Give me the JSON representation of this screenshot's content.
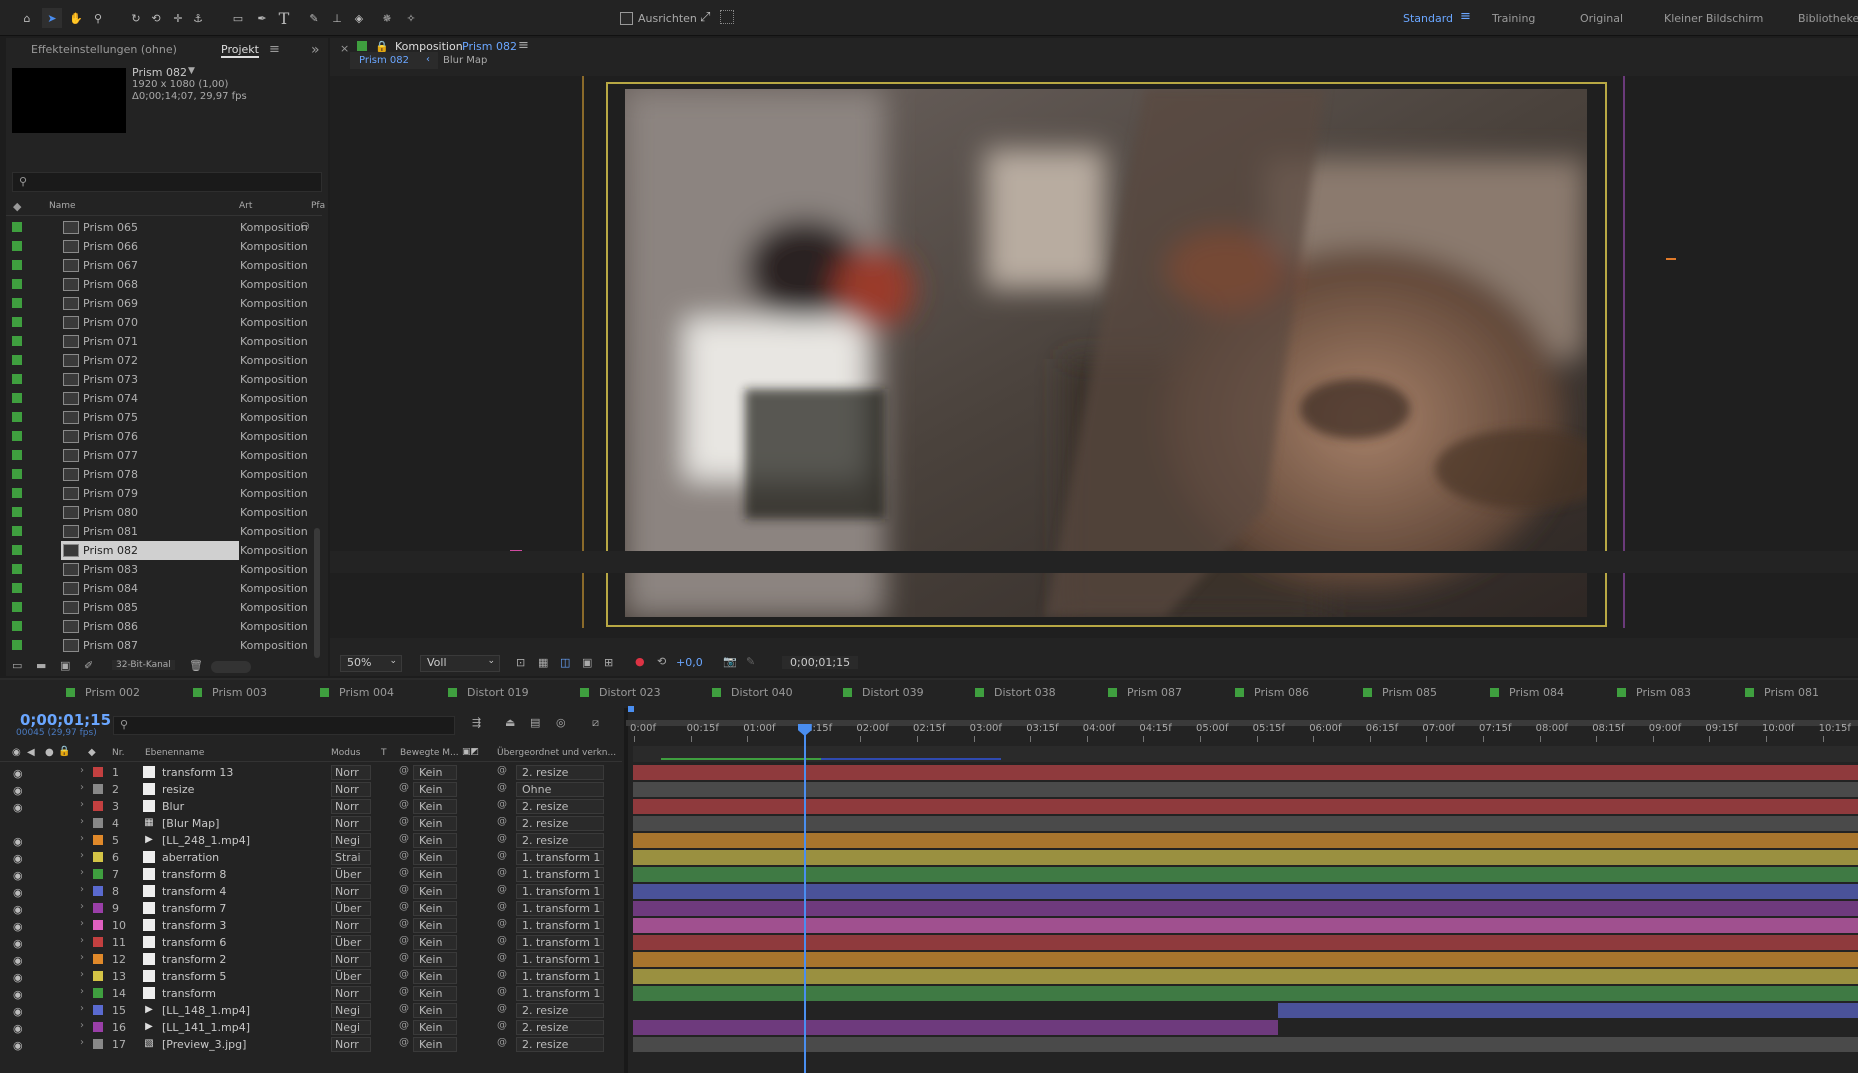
{
  "toolbar": {
    "align_label": "Ausrichten",
    "workspaces": [
      "Standard",
      "Training",
      "Original",
      "Kleiner Bildschirm",
      "Bibliotheken"
    ],
    "active_workspace": "Standard",
    "icons": [
      "home-icon",
      "selection-arrow-icon",
      "hand-icon",
      "zoom-icon",
      "rotate-icon",
      "camera-orbit-icon",
      "pan-behind-icon",
      "anchor-icon",
      "rectangle-icon",
      "pen-icon",
      "text-icon",
      "brush-icon",
      "clone-stamp-icon",
      "eraser-icon",
      "roto-brush-icon",
      "puppet-pin-icon"
    ]
  },
  "project": {
    "tab_effects": "Effekteinstellungen (ohne)",
    "tab_project": "Projekt",
    "preview_name": "Prism 082",
    "preview_res": "1920 x 1080 (1,00)",
    "preview_dur": "Δ0;00;14;07, 29,97 fps",
    "search_placeholder": "",
    "col_name": "Name",
    "col_art": "Art",
    "col_pfa": "Pfa",
    "selected": "Prism 082",
    "items": [
      {
        "name": "Prism 065",
        "art": "Komposition"
      },
      {
        "name": "Prism 066",
        "art": "Komposition"
      },
      {
        "name": "Prism 067",
        "art": "Komposition"
      },
      {
        "name": "Prism 068",
        "art": "Komposition"
      },
      {
        "name": "Prism 069",
        "art": "Komposition"
      },
      {
        "name": "Prism 070",
        "art": "Komposition"
      },
      {
        "name": "Prism 071",
        "art": "Komposition"
      },
      {
        "name": "Prism 072",
        "art": "Komposition"
      },
      {
        "name": "Prism 073",
        "art": "Komposition"
      },
      {
        "name": "Prism 074",
        "art": "Komposition"
      },
      {
        "name": "Prism 075",
        "art": "Komposition"
      },
      {
        "name": "Prism 076",
        "art": "Komposition"
      },
      {
        "name": "Prism 077",
        "art": "Komposition"
      },
      {
        "name": "Prism 078",
        "art": "Komposition"
      },
      {
        "name": "Prism 079",
        "art": "Komposition"
      },
      {
        "name": "Prism 080",
        "art": "Komposition"
      },
      {
        "name": "Prism 081",
        "art": "Komposition"
      },
      {
        "name": "Prism 082",
        "art": "Komposition"
      },
      {
        "name": "Prism 083",
        "art": "Komposition"
      },
      {
        "name": "Prism 084",
        "art": "Komposition"
      },
      {
        "name": "Prism 085",
        "art": "Komposition"
      },
      {
        "name": "Prism 086",
        "art": "Komposition"
      },
      {
        "name": "Prism 087",
        "art": "Komposition"
      }
    ],
    "bit_depth": "32-Bit-Kanal"
  },
  "viewer": {
    "panel_label": "Komposition",
    "comp_name": "Prism 082",
    "breadcrumb_active": "Prism 082",
    "breadcrumb_next": "Blur Map",
    "zoom": "50%",
    "resolution": "Voll",
    "exposure": "+0,0",
    "timecode": "0;00;01;15"
  },
  "timeline": {
    "comp_tabs": [
      {
        "name": "Prism 002",
        "color": "#3f9f3f"
      },
      {
        "name": "Prism 003",
        "color": "#3f9f3f"
      },
      {
        "name": "Prism 004",
        "color": "#3f9f3f"
      },
      {
        "name": "Distort 019",
        "color": "#3f9f3f"
      },
      {
        "name": "Distort 023",
        "color": "#3f9f3f"
      },
      {
        "name": "Distort 040",
        "color": "#3f9f3f"
      },
      {
        "name": "Distort 039",
        "color": "#3f9f3f"
      },
      {
        "name": "Distort 038",
        "color": "#3f9f3f"
      },
      {
        "name": "Prism 087",
        "color": "#3f9f3f"
      },
      {
        "name": "Prism 086",
        "color": "#3f9f3f"
      },
      {
        "name": "Prism 085",
        "color": "#3f9f3f"
      },
      {
        "name": "Prism 084",
        "color": "#3f9f3f"
      },
      {
        "name": "Prism 083",
        "color": "#3f9f3f"
      },
      {
        "name": "Prism 081",
        "color": "#3f9f3f"
      }
    ],
    "timecode": "0;00;01;15",
    "frame_info": "00045 (29,97 fps)",
    "headers": {
      "nr": "Nr.",
      "name": "Ebenenname",
      "mode": "Modus",
      "t": "T",
      "motion": "Bewegte M...",
      "parent": "Übergeordnet und verkn..."
    },
    "ruler": [
      "0:00f",
      "00:15f",
      "01:00f",
      "01:15f",
      "02:00f",
      "02:15f",
      "03:00f",
      "03:15f",
      "04:00f",
      "04:15f",
      "05:00f",
      "05:15f",
      "06:00f",
      "06:15f",
      "07:00f",
      "07:15f",
      "08:00f",
      "08:15f",
      "09:00f",
      "09:15f",
      "10:00f",
      "10:15f"
    ],
    "current_time_seconds": 1.5,
    "layers": [
      {
        "nr": "1",
        "name": "transform 13",
        "mode": "Norr",
        "motion": "Kein",
        "parent": "2. resize",
        "label": "#c34040",
        "bar": "#8f3a3d",
        "icon": "solid",
        "eye": true
      },
      {
        "nr": "2",
        "name": "resize",
        "mode": "Norr",
        "motion": "Kein",
        "parent": "Ohne",
        "label": "#888888",
        "bar": "#4a4a4a",
        "icon": "solid",
        "eye": true
      },
      {
        "nr": "3",
        "name": "Blur",
        "mode": "Norr",
        "motion": "Kein",
        "parent": "2. resize",
        "label": "#c34040",
        "bar": "#8f3a3d",
        "icon": "solid",
        "eye": true
      },
      {
        "nr": "4",
        "name": "[Blur Map]",
        "mode": "Norr",
        "motion": "Kein",
        "parent": "2. resize",
        "label": "#888888",
        "bar": "#4a4a4a",
        "icon": "comp",
        "eye": false
      },
      {
        "nr": "5",
        "name": "[LL_248_1.mp4]",
        "mode": "Negi",
        "motion": "Kein",
        "parent": "2. resize",
        "label": "#e0892a",
        "bar": "#a8752d",
        "icon": "footage",
        "eye": true
      },
      {
        "nr": "6",
        "name": "aberration",
        "mode": "Strai",
        "motion": "Kein",
        "parent": "1. transform 1",
        "label": "#d4c446",
        "bar": "#9a9040",
        "icon": "solid",
        "eye": true
      },
      {
        "nr": "7",
        "name": "transform 8",
        "mode": "Über",
        "motion": "Kein",
        "parent": "1. transform 1",
        "label": "#3f9f3f",
        "bar": "#3f7a44",
        "icon": "solid",
        "eye": true
      },
      {
        "nr": "8",
        "name": "transform 4",
        "mode": "Norr",
        "motion": "Kein",
        "parent": "1. transform 1",
        "label": "#5a6acf",
        "bar": "#4a5299",
        "icon": "solid",
        "eye": true
      },
      {
        "nr": "9",
        "name": "transform 7",
        "mode": "Über",
        "motion": "Kein",
        "parent": "1. transform 1",
        "label": "#9a3fa8",
        "bar": "#6e3a7d",
        "icon": "solid",
        "eye": true
      },
      {
        "nr": "10",
        "name": "transform 3",
        "mode": "Norr",
        "motion": "Kein",
        "parent": "1. transform 1",
        "label": "#e060c0",
        "bar": "#a0508f",
        "icon": "solid",
        "eye": true
      },
      {
        "nr": "11",
        "name": "transform 6",
        "mode": "Über",
        "motion": "Kein",
        "parent": "1. transform 1",
        "label": "#c34040",
        "bar": "#8f3a3d",
        "icon": "solid",
        "eye": true
      },
      {
        "nr": "12",
        "name": "transform 2",
        "mode": "Norr",
        "motion": "Kein",
        "parent": "1. transform 1",
        "label": "#e0892a",
        "bar": "#a8752d",
        "icon": "solid",
        "eye": true
      },
      {
        "nr": "13",
        "name": "transform 5",
        "mode": "Über",
        "motion": "Kein",
        "parent": "1. transform 1",
        "label": "#d4c446",
        "bar": "#9a9040",
        "icon": "solid",
        "eye": true
      },
      {
        "nr": "14",
        "name": "transform",
        "mode": "Norr",
        "motion": "Kein",
        "parent": "1. transform 1",
        "label": "#3f9f3f",
        "bar": "#3f7a44",
        "icon": "solid",
        "eye": true
      },
      {
        "nr": "15",
        "name": "[LL_148_1.mp4]",
        "mode": "Negi",
        "motion": "Kein",
        "parent": "2. resize",
        "label": "#5a6acf",
        "bar": "#4a5299",
        "icon": "footage",
        "eye": true
      },
      {
        "nr": "16",
        "name": "[LL_141_1.mp4]",
        "mode": "Negi",
        "motion": "Kein",
        "parent": "2. resize",
        "label": "#9a3fa8",
        "bar": "#6e3a7d",
        "icon": "footage",
        "eye": true
      },
      {
        "nr": "17",
        "name": "[Preview_3.jpg]",
        "mode": "Norr",
        "motion": "Kein",
        "parent": "2. resize",
        "label": "#888888",
        "bar": "#4a4a4a",
        "icon": "still",
        "eye": true
      }
    ]
  }
}
